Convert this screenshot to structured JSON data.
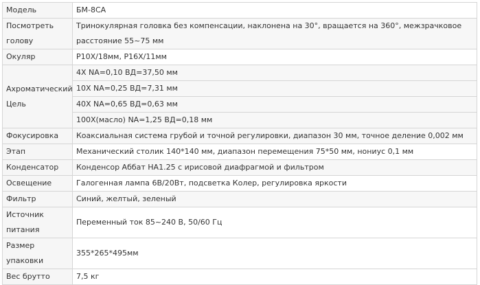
{
  "rows": [
    {
      "label": "Модель",
      "value": "БМ-8СА"
    },
    {
      "label": "Посмотреть голову",
      "value": "Тринокулярная головка без компенсации, наклонена на 30°, вращается на 360°, межзрачковое расстояние 55~75 мм"
    },
    {
      "label": "Окуляр",
      "value": "P10X/18мм, P16X/11мм"
    },
    {
      "label": "Ахроматический Цель",
      "values": [
        "4X NA=0,10 ВД=37,50 мм",
        "10X NA=0,25 ВД=7,31 мм",
        "40X NA=0,65 ВД=0,63 мм",
        "100X(масло) NA=1,25 ВД=0,18 мм"
      ]
    },
    {
      "label": "Фокусировка",
      "value": "Коаксиальная система грубой и точной регулировки, диапазон 30 мм, точное деление 0,002 мм"
    },
    {
      "label": "Этап",
      "value": "Механический столик 140*140 мм, диапазон перемещения 75*50 мм, нониус 0,1 мм"
    },
    {
      "label": "Конденсатор",
      "value": "Конденсор Аббат НА1.25 с ирисовой диафрагмой и фильтром"
    },
    {
      "label": "Освещение",
      "value": "Галогенная лампа 6В/20Вт, подсветка Колер, регулировка яркости"
    },
    {
      "label": "Фильтр",
      "value": "Синий, желтый, зеленый"
    },
    {
      "label": "Источник питания",
      "value": "Переменный ток 85~240 В, 50/60 Гц"
    },
    {
      "label": "Размер упаковки",
      "value": "355*265*495мм"
    },
    {
      "label": "Вес брутто",
      "value": "7,5 кг"
    }
  ]
}
